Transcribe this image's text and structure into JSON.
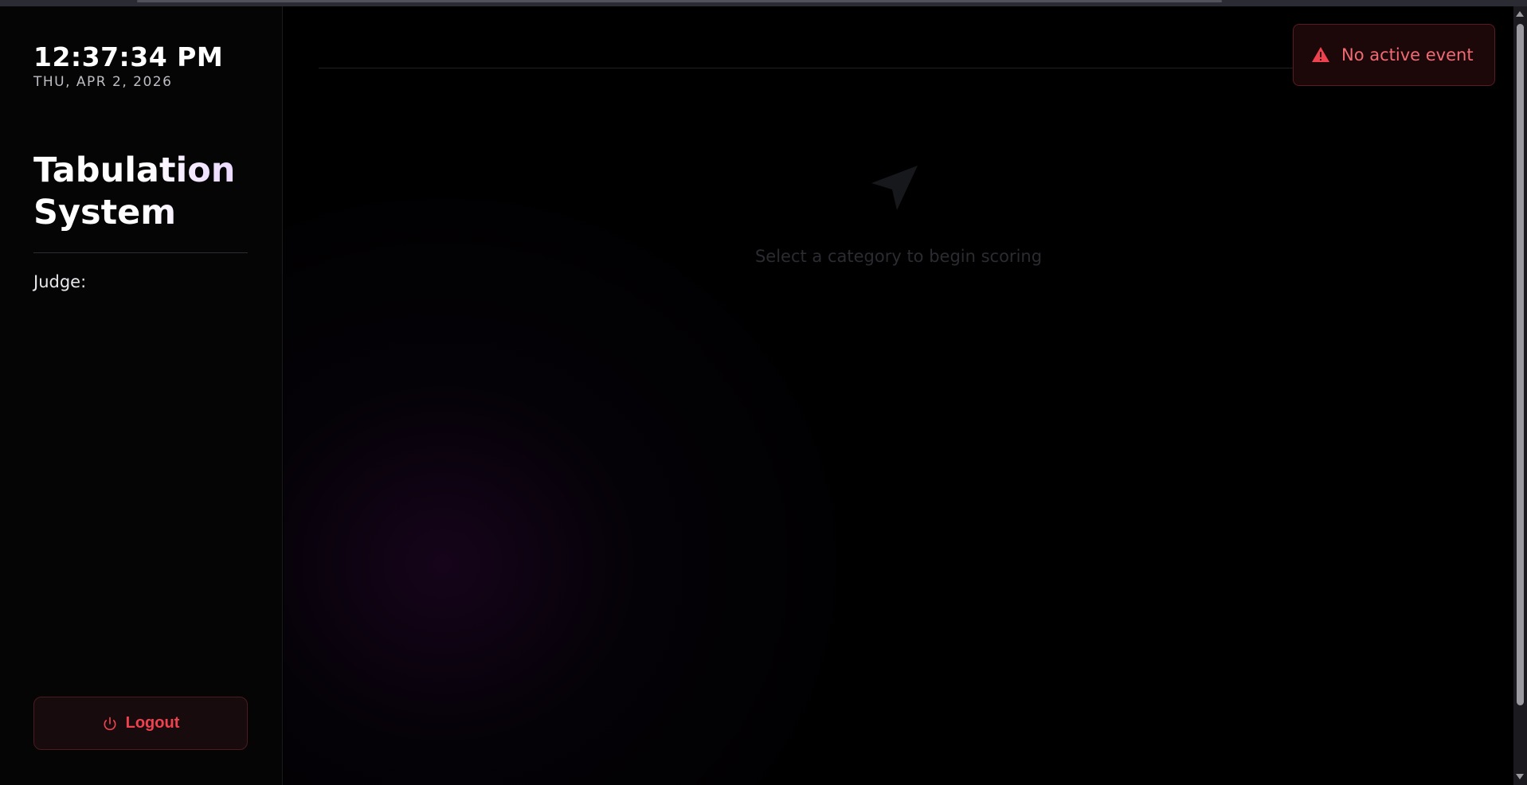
{
  "sidebar": {
    "clock_time": "12:37:34 PM",
    "clock_date": "THU, APR 2, 2026",
    "app_title_line1": "Tabulation",
    "app_title_line2": "System",
    "judge_label": "Judge:",
    "logout_label": "Logout",
    "logout_icon": "power-icon"
  },
  "main": {
    "empty_state_icon": "navigation-arrow-icon",
    "empty_state_text": "Select a category to begin scoring"
  },
  "alert": {
    "icon": "warning-triangle-icon",
    "text": "No active event"
  },
  "colors": {
    "accent_red": "#f0414f",
    "alert_text": "#f06a74",
    "title_gradient_end": "#e2c8ff"
  }
}
